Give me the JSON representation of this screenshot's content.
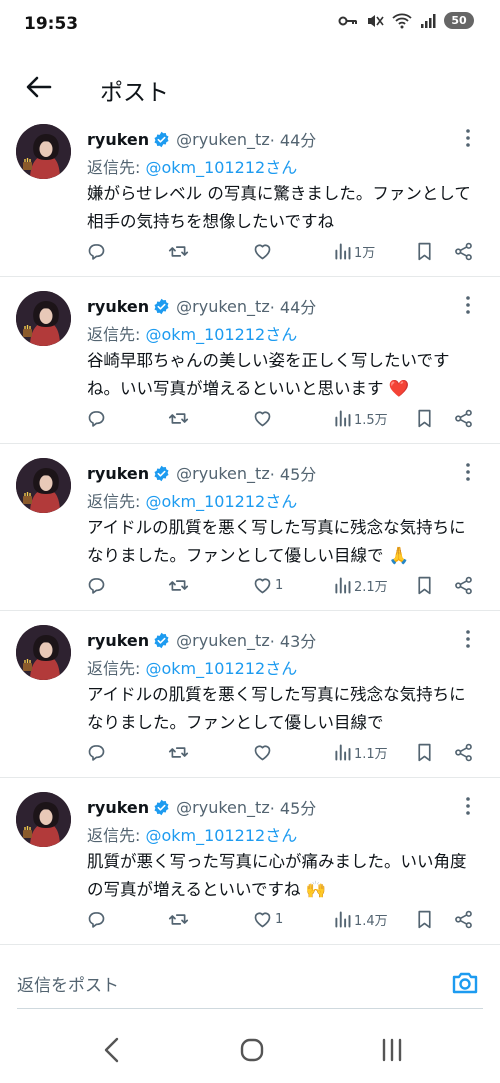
{
  "status": {
    "time": "19:53",
    "battery": "50"
  },
  "appbar": {
    "title": "ポスト"
  },
  "tweets": [
    {
      "name": "ryuken",
      "handle": "@ryuken_tz",
      "time": "· 44分",
      "reply_prefix": "返信先: ",
      "reply_mention": "@okm_101212さん",
      "text": "嫌がらせレベル の写真に驚きました。ファンとして相手の気持ちを想像したいですね",
      "likes": "",
      "views": "1万"
    },
    {
      "name": "ryuken",
      "handle": "@ryuken_tz",
      "time": "· 44分",
      "reply_prefix": "返信先: ",
      "reply_mention": "@okm_101212さん",
      "text": "谷崎早耶ちゃんの美しい姿を正しく写したいですね。いい写真が増えるといいと思います ❤️",
      "likes": "",
      "views": "1.5万"
    },
    {
      "name": "ryuken",
      "handle": "@ryuken_tz",
      "time": "· 45分",
      "reply_prefix": "返信先: ",
      "reply_mention": "@okm_101212さん",
      "text": "アイドルの肌質を悪く写した写真に残念な気持ちになりました。ファンとして優しい目線で 🙏",
      "likes": "1",
      "views": "2.1万"
    },
    {
      "name": "ryuken",
      "handle": "@ryuken_tz",
      "time": "· 43分",
      "reply_prefix": "返信先: ",
      "reply_mention": "@okm_101212さん",
      "text": "アイドルの肌質を悪く写した写真に残念な気持ちになりました。ファンとして優しい目線で",
      "likes": "",
      "views": "1.1万"
    },
    {
      "name": "ryuken",
      "handle": "@ryuken_tz",
      "time": "· 45分",
      "reply_prefix": "返信先: ",
      "reply_mention": "@okm_101212さん",
      "text": "肌質が悪く写った写真に心が痛みました。いい角度の写真が増えるといいですね 🙌",
      "likes": "1",
      "views": "1.4万"
    }
  ],
  "reply_bar": {
    "placeholder": "返信をポスト"
  },
  "colors": {
    "accent": "#1d9bf0",
    "secondary_text": "#536471",
    "divider": "#e6e9ea"
  },
  "icons": [
    "back-arrow-icon",
    "verified-badge-icon",
    "more-vertical-icon",
    "reply-icon",
    "retweet-icon",
    "like-icon",
    "views-icon",
    "bookmark-icon",
    "share-icon",
    "camera-icon"
  ]
}
